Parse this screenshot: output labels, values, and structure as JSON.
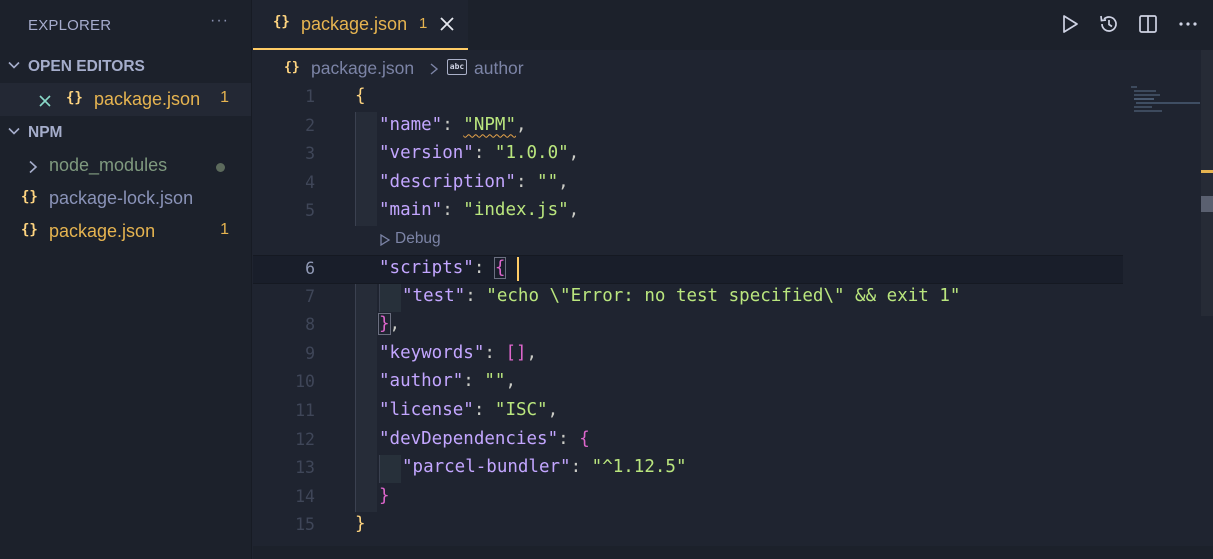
{
  "sidebar": {
    "title": "EXPLORER",
    "more": "···",
    "open_editors": {
      "title": "OPEN EDITORS",
      "items": [
        {
          "icon": "{}",
          "label": "package.json",
          "badge": "1"
        }
      ]
    },
    "folder": {
      "title": "NPM",
      "items": [
        {
          "label": "node_modules",
          "type": "folder"
        },
        {
          "icon": "{}",
          "label": "package-lock.json"
        },
        {
          "icon": "{}",
          "label": "package.json",
          "badge": "1"
        }
      ]
    }
  },
  "tab": {
    "icon": "{}",
    "label": "package.json",
    "count": "1"
  },
  "breadcrumb": {
    "icon": "{}",
    "file": "package.json",
    "symbol_icon": "abc",
    "symbol": "author"
  },
  "codelens": {
    "label": "Debug"
  },
  "line_numbers": [
    "1",
    "2",
    "3",
    "4",
    "5",
    "6",
    "7",
    "8",
    "9",
    "10",
    "11",
    "12",
    "13",
    "14",
    "15"
  ],
  "code": {
    "l1": "{",
    "l2k": "\"name\"",
    "l2v": "\"NPM\"",
    "l3k": "\"version\"",
    "l3v": "\"1.0.0\"",
    "l4k": "\"description\"",
    "l4v": "\"\"",
    "l5k": "\"main\"",
    "l5v": "\"index.js\"",
    "l6k": "\"scripts\"",
    "l6b": "{",
    "l7k": "\"test\"",
    "l7v": "\"echo \\\"Error: no test specified\\\" && exit 1\"",
    "l8b": "}",
    "l9k": "\"keywords\"",
    "l9v": "[]",
    "l10k": "\"author\"",
    "l10v": "\"\"",
    "l11k": "\"license\"",
    "l11v": "\"ISC\"",
    "l12k": "\"devDependencies\"",
    "l12b": "{",
    "l13k": "\"parcel-bundler\"",
    "l13v": "\"^1.12.5\"",
    "l14b": "}",
    "l15": "}"
  },
  "colors": {
    "accent": "#ffcc66",
    "key": "#c3a6ff",
    "string": "#bae67e",
    "warning": "#e6b450"
  }
}
